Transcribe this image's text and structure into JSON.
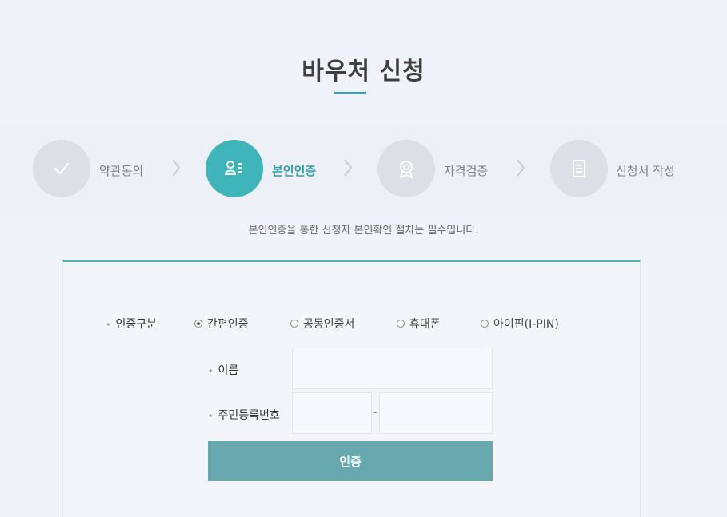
{
  "page_title": "바우처 신청",
  "steps": [
    {
      "label": "약관동의",
      "icon": "check-icon",
      "active": false
    },
    {
      "label": "본인인증",
      "icon": "id-card-icon",
      "active": true
    },
    {
      "label": "자격검증",
      "icon": "badge-icon",
      "active": false
    },
    {
      "label": "신청서 작성",
      "icon": "document-icon",
      "active": false
    }
  ],
  "notice": "본인인증을 통한 신청자 본인확인 절차는 필수입니다.",
  "form": {
    "auth_type_label": "인증구분",
    "auth_options": [
      {
        "label": "간편인증",
        "checked": true
      },
      {
        "label": "공동인증서",
        "checked": false
      },
      {
        "label": "휴대폰",
        "checked": false
      },
      {
        "label": "아이핀(I-PIN)",
        "checked": false
      }
    ],
    "name_label": "이름",
    "name_value": "",
    "rrn_label": "주민등록번호",
    "rrn_front_value": "",
    "rrn_back_value": "",
    "rrn_separator": "-",
    "submit_label": "인증"
  },
  "colors": {
    "accent": "#3fb4b9",
    "button": "#67a9ae",
    "inactive_step": "#dcdfe6"
  }
}
